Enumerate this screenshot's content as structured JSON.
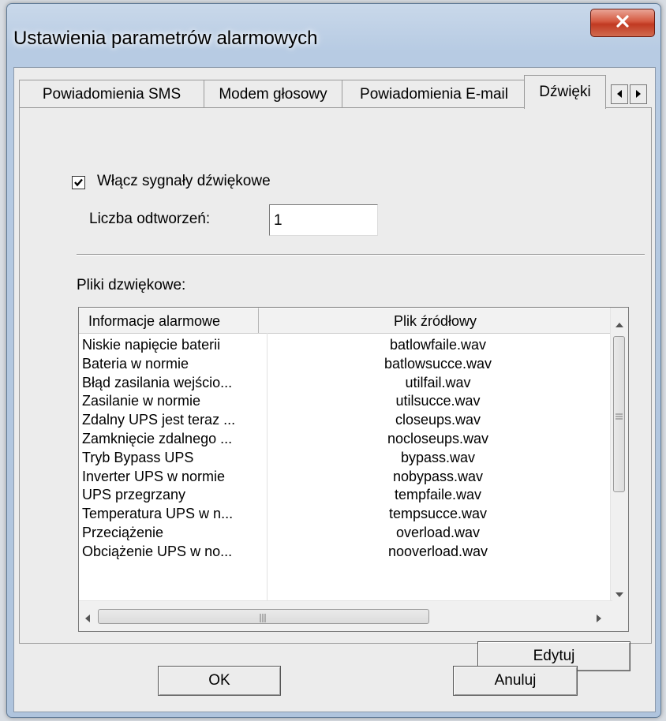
{
  "window": {
    "title": "Ustawienia parametrów alarmowych",
    "close_icon": "close-icon"
  },
  "tabs": [
    {
      "label": "Powiadomienia SMS"
    },
    {
      "label": "Modem głosowy"
    },
    {
      "label": "Powiadomienia E-mail"
    },
    {
      "label": "Dźwięki",
      "active": true
    }
  ],
  "tab_scroll": {
    "left_icon": "tab-scroll-left-icon",
    "right_icon": "tab-scroll-right-icon"
  },
  "sound_settings": {
    "enable_label": "Włącz sygnały dźwiękowe",
    "enabled": true,
    "count_label": "Liczba odtworzeń:",
    "count_value": "1",
    "files_label": "Pliki dzwiękowe:"
  },
  "table": {
    "columns": [
      "Informacje alarmowe",
      "Plik źródłowy"
    ],
    "rows": [
      [
        "Niskie napięcie baterii",
        "batlowfaile.wav"
      ],
      [
        "Bateria w normie",
        "batlowsucce.wav"
      ],
      [
        "Błąd zasilania wejścio...",
        "utilfail.wav"
      ],
      [
        "Zasilanie w normie",
        "utilsucce.wav"
      ],
      [
        "Zdalny UPS jest teraz ...",
        "closeups.wav"
      ],
      [
        "Zamknięcie zdalnego ...",
        "nocloseups.wav"
      ],
      [
        "Tryb Bypass UPS",
        "bypass.wav"
      ],
      [
        "Inverter UPS w normie",
        "nobypass.wav"
      ],
      [
        "UPS przegrzany",
        "tempfaile.wav"
      ],
      [
        "Temperatura UPS w n...",
        "tempsucce.wav"
      ],
      [
        "Przeciążenie",
        "overload.wav"
      ],
      [
        "Obciążenie UPS w no...",
        "nooverload.wav"
      ]
    ]
  },
  "buttons": {
    "edit": "Edytuj",
    "ok": "OK",
    "cancel": "Anuluj"
  },
  "colors": {
    "title_bar": "#b7cbe3",
    "close_button": "#c13a22",
    "dialog_background": "#ececec"
  }
}
